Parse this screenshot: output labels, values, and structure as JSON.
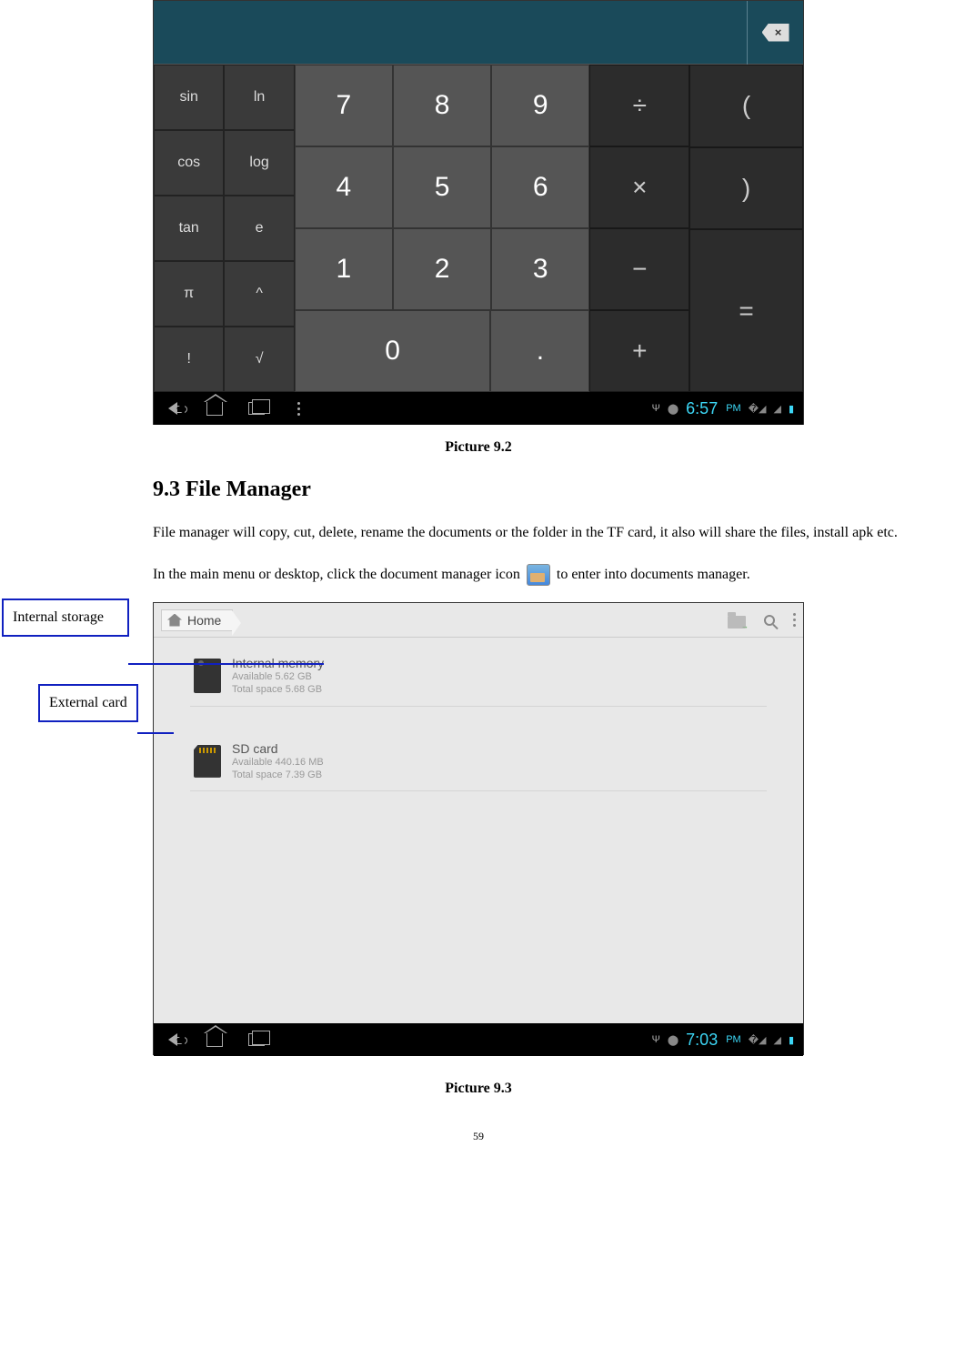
{
  "calculator": {
    "func_keys": [
      [
        "sin",
        "ln"
      ],
      [
        "cos",
        "log"
      ],
      [
        "tan",
        "e"
      ],
      [
        "π",
        "^"
      ],
      [
        "!",
        "√"
      ]
    ],
    "num_rows": [
      [
        "7",
        "8",
        "9"
      ],
      [
        "4",
        "5",
        "6"
      ],
      [
        "1",
        "2",
        "3"
      ]
    ],
    "zero": "0",
    "dot": ".",
    "ops": [
      "÷",
      "×",
      "−",
      "+"
    ],
    "parens": [
      "(",
      ")"
    ],
    "equals": "=",
    "backspace_x": "×",
    "navbar": {
      "time": "6:57",
      "pm": "PM"
    }
  },
  "caption1": "Picture 9.2",
  "section_heading": "9.3 File Manager",
  "para1": "File manager will copy, cut, delete, rename the documents or the folder in the TF card, it also will share the files, install apk etc.",
  "para2a": "In the main menu or desktop, click the document manager icon ",
  "para2b": " to enter into documents manager.",
  "annotations": {
    "internal": "Internal storage",
    "external": "External card"
  },
  "filemanager": {
    "home": "Home",
    "internal": {
      "title": "Internal memory",
      "avail": "Available 5.62 GB",
      "total": "Total space 5.68 GB"
    },
    "sd": {
      "title": "SD card",
      "avail": "Available 440.16 MB",
      "total": "Total space 7.39 GB"
    },
    "navbar": {
      "time": "7:03",
      "pm": "PM"
    }
  },
  "caption2": "Picture 9.3",
  "page_number": "59"
}
